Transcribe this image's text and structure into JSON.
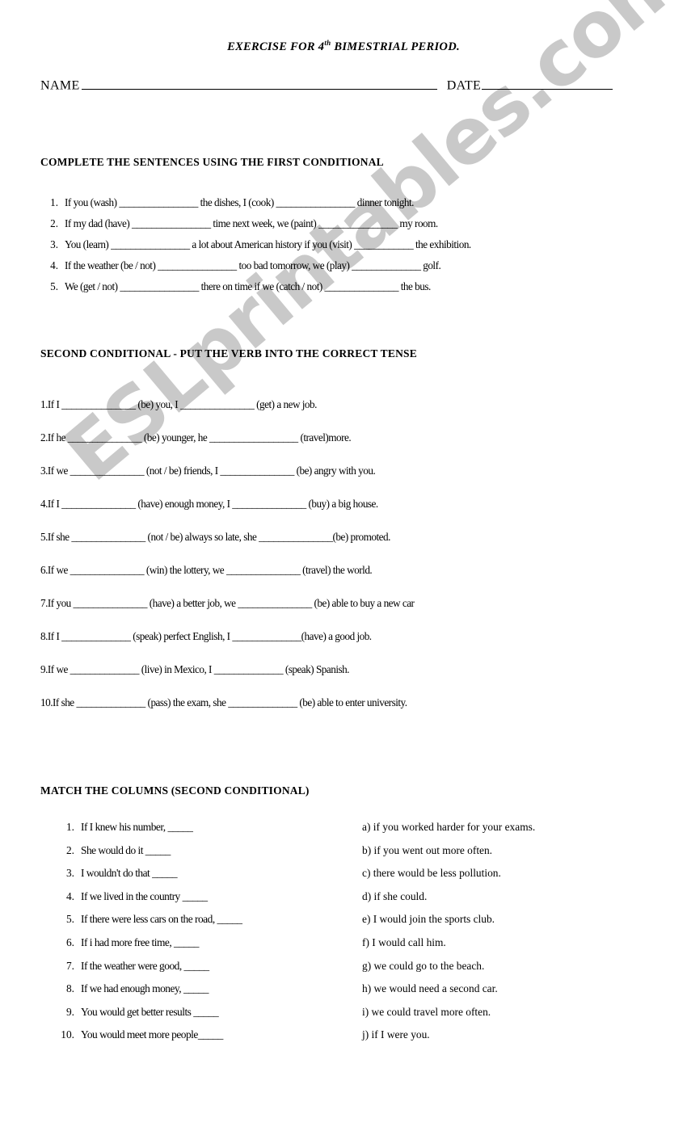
{
  "document": {
    "title_prefix": "EXERCISE FOR 4",
    "title_sup": "th",
    "title_suffix": " BIMESTRIAL PERIOD.",
    "watermark": "ESLprintables.com"
  },
  "header": {
    "name_label": "NAME",
    "date_label": "DATE"
  },
  "section_first": {
    "heading": "COMPLETE THE SENTENCES USING THE FIRST CONDITIONAL",
    "items": [
      {
        "num": "1.",
        "text": "If you (wash) ________________ the dishes, I (cook) ________________ dinner tonight."
      },
      {
        "num": "2.",
        "text": "If my dad (have) ________________  time next week, we (paint) ________________ my room."
      },
      {
        "num": "3.",
        "text": "You (learn) ________________ a lot about American history if you (visit) ____________ the exhibition."
      },
      {
        "num": "4.",
        "text": "If the weather (be / not) ________________ too bad tomorrow, we (play) ______________ golf."
      },
      {
        "num": "5.",
        "text": "We (get / not) ________________ there on time if we (catch / not) _______________ the bus."
      }
    ]
  },
  "section_second": {
    "heading": "SECOND CONDITIONAL - PUT THE VERB INTO THE CORRECT TENSE",
    "items": [
      {
        "text": "1.If I _______________ (be) you, I _______________ (get) a new job."
      },
      {
        "text": "2.If he _______________ (be) younger, he __________________ (travel)more."
      },
      {
        "text": "3.If we _______________ (not / be) friends, I _______________ (be) angry with you."
      },
      {
        "text": "4.If I _______________ (have) enough money, I _______________ (buy) a big house."
      },
      {
        "text": "5.If she _______________ (not / be) always so late, she _______________(be) promoted."
      },
      {
        "text": "6.If we _______________ (win) the lottery, we _______________ (travel) the world."
      },
      {
        "text": "7.If you _______________ (have) a better job, we _______________ (be) able to buy a new car"
      },
      {
        "text": "8.If I ______________ (speak) perfect English, I ______________(have) a good job."
      },
      {
        "text": "9.If we ______________ (live) in Mexico, I ______________ (speak) Spanish."
      },
      {
        "text": "10.If she ______________ (pass) the exam, she ______________ (be) able to enter university."
      }
    ]
  },
  "section_match": {
    "heading": "MATCH THE COLUMNS (SECOND CONDITIONAL)",
    "left_items": [
      {
        "num": "1.",
        "text": "If I knew his number, _____"
      },
      {
        "num": "2.",
        "text": "She would do it  _____"
      },
      {
        "num": "3.",
        "text": "I wouldn't do that  _____"
      },
      {
        "num": "4.",
        "text": "If we lived in the country  _____"
      },
      {
        "num": "5.",
        "text": "If there were less cars on the road, _____"
      },
      {
        "num": "6.",
        "text": "If i had more free time, _____"
      },
      {
        "num": "7.",
        "text": "If the weather were good,  _____"
      },
      {
        "num": "8.",
        "text": "If we had enough money, _____"
      },
      {
        "num": "9.",
        "text": "You would get better results _____"
      },
      {
        "num": "10.",
        "text": "You would meet more people_____"
      }
    ],
    "right_items": [
      {
        "text": "a) if you worked harder for your exams."
      },
      {
        "text": "b) if you went out more often."
      },
      {
        "text": "c) there would be less pollution."
      },
      {
        "text": "d) if she could."
      },
      {
        "text": "e) I would join the sports club."
      },
      {
        "text": "f) I would call him."
      },
      {
        "text": "g) we could go to the beach."
      },
      {
        "text": "h) we would need a second car."
      },
      {
        "text": "i) we could travel more often."
      },
      {
        "text": "j) if I were you."
      }
    ]
  }
}
